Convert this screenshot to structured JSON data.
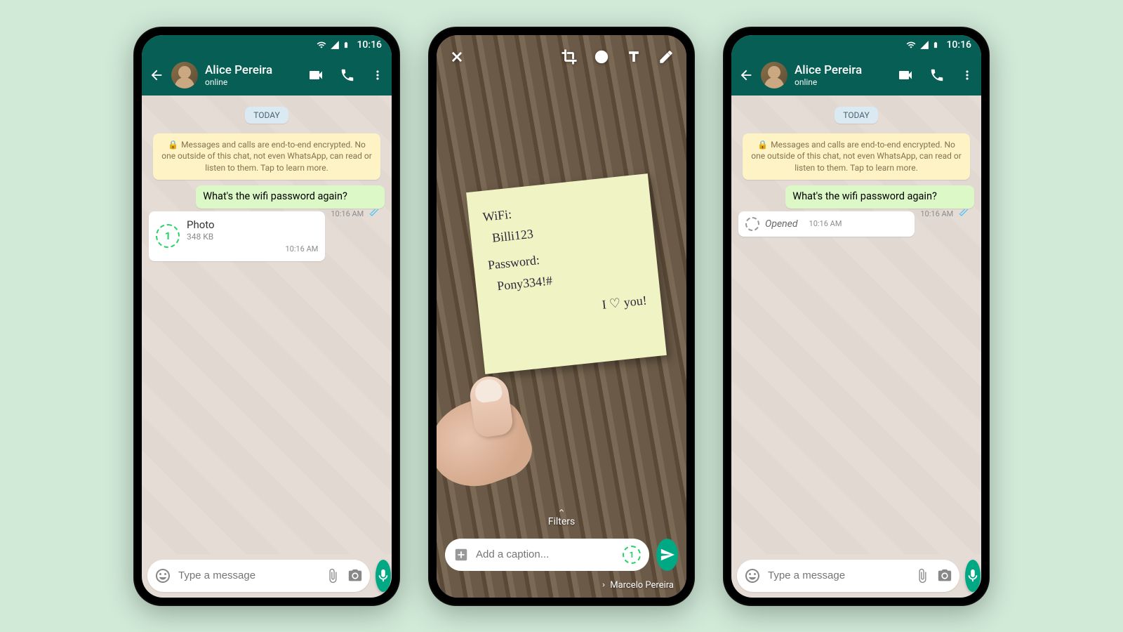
{
  "status": {
    "time": "10:16"
  },
  "chat1": {
    "contact_name": "Alice Pereira",
    "contact_status": "online",
    "date_label": "TODAY",
    "encryption_text": "Messages and calls are end-to-end encrypted. No one outside of this chat, not even WhatsApp, can read or listen to them. Tap to learn more.",
    "msg_out_text": "What's the wifi password again?",
    "msg_out_time": "10:16 AM",
    "media_title": "Photo",
    "media_size": "348 KB",
    "media_time": "10:16 AM",
    "input_placeholder": "Type a message"
  },
  "editor": {
    "note_line1": "WiFi:",
    "note_line2": "Billi123",
    "note_line3": "Password:",
    "note_line4": "Pony334!#",
    "note_line5": "I ♡ you!",
    "filters_label": "Filters",
    "caption_placeholder": "Add a caption...",
    "view_once_digit": "1",
    "recipient": "Marcelo Pereira"
  },
  "chat3": {
    "opened_label": "Opened",
    "opened_time": "10:16 AM"
  }
}
